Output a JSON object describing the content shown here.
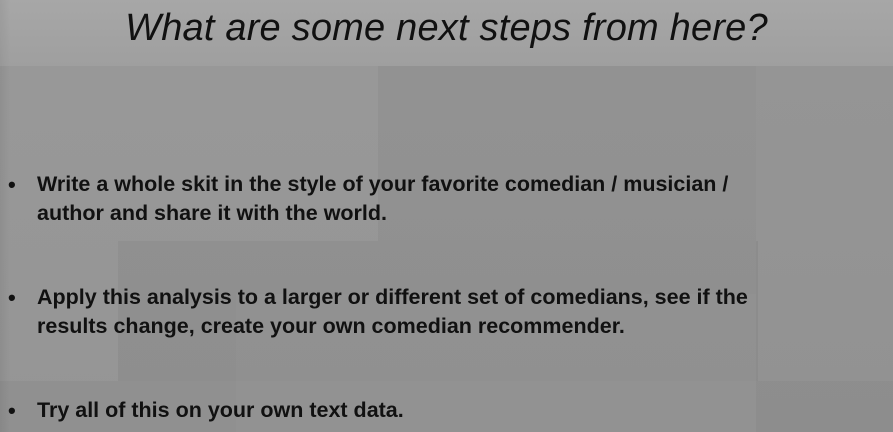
{
  "slide": {
    "title": "What are some next steps from here?",
    "bullets": [
      {
        "marker": "•",
        "lines": [
          "Write a whole skit in the style of your favorite comedian / musician /",
          "author and share it with the world."
        ]
      },
      {
        "marker": "•",
        "lines": [
          "Apply this analysis to a larger or different set of comedians, see if the",
          "results change, create your own comedian recommender."
        ]
      },
      {
        "marker": "•",
        "lines": [
          "Try all of this on your own text data."
        ]
      }
    ]
  }
}
